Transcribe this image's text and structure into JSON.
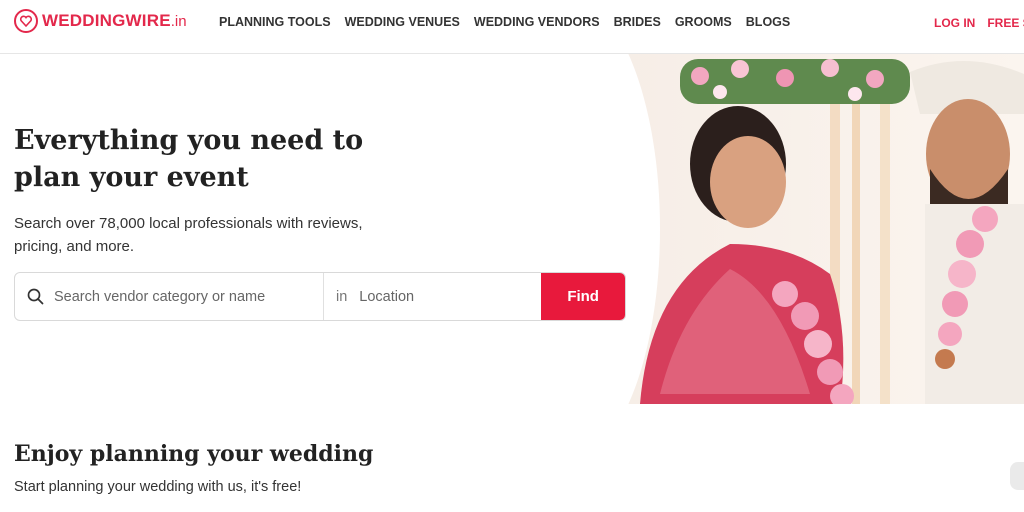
{
  "brand": {
    "name": "WEDDINGWIRE",
    "tld": ".in",
    "accent_color": "#e3284b",
    "logo_icon": "heart-ring-icon"
  },
  "nav": {
    "items": [
      {
        "label": "PLANNING TOOLS"
      },
      {
        "label": "WEDDING VENUES"
      },
      {
        "label": "WEDDING VENDORS"
      },
      {
        "label": "BRIDES"
      },
      {
        "label": "GROOMS"
      },
      {
        "label": "BLOGS"
      }
    ],
    "login": "LOG IN",
    "signup": "FREE S"
  },
  "hero": {
    "title": "Everything you need to plan your event",
    "subtitle": "Search over 78,000 local professionals with reviews, pricing, and more.",
    "search": {
      "category_placeholder": "Search vendor category or name",
      "location_prefix": "in",
      "location_placeholder": "Location",
      "button_label": "Find",
      "button_color": "#e8193c"
    },
    "image": "bride-and-groom-photo"
  },
  "section": {
    "title": "Enjoy planning your wedding",
    "subtitle": "Start planning your wedding with us, it's free!"
  }
}
